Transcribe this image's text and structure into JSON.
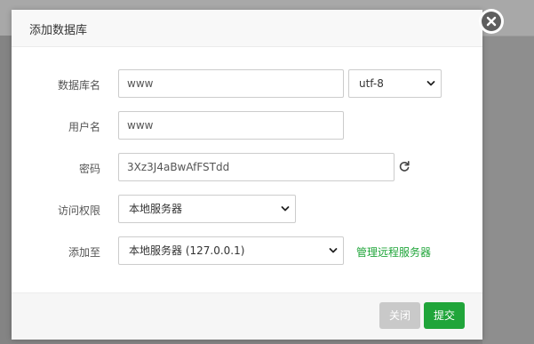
{
  "dialog": {
    "title": "添加数据库"
  },
  "form": {
    "db_name": {
      "label": "数据库名",
      "value": "www"
    },
    "charset": {
      "value": "utf-8"
    },
    "username": {
      "label": "用户名",
      "value": "www"
    },
    "password": {
      "label": "密码",
      "value": "3Xz3J4aBwAfFSTdd"
    },
    "access": {
      "label": "访问权限",
      "value": "本地服务器"
    },
    "add_to": {
      "label": "添加至",
      "value": "本地服务器 (127.0.0.1)",
      "manage_link": "管理远程服务器"
    }
  },
  "footer": {
    "close_label": "关闭",
    "submit_label": "提交"
  },
  "colors": {
    "accent": "#20a53a",
    "disabled_button": "#c9c9c9",
    "close_icon": "#5f5f5f"
  },
  "icons": {
    "close": "close-icon",
    "refresh": "refresh-icon",
    "dropdown": "chevron-down-icon"
  }
}
